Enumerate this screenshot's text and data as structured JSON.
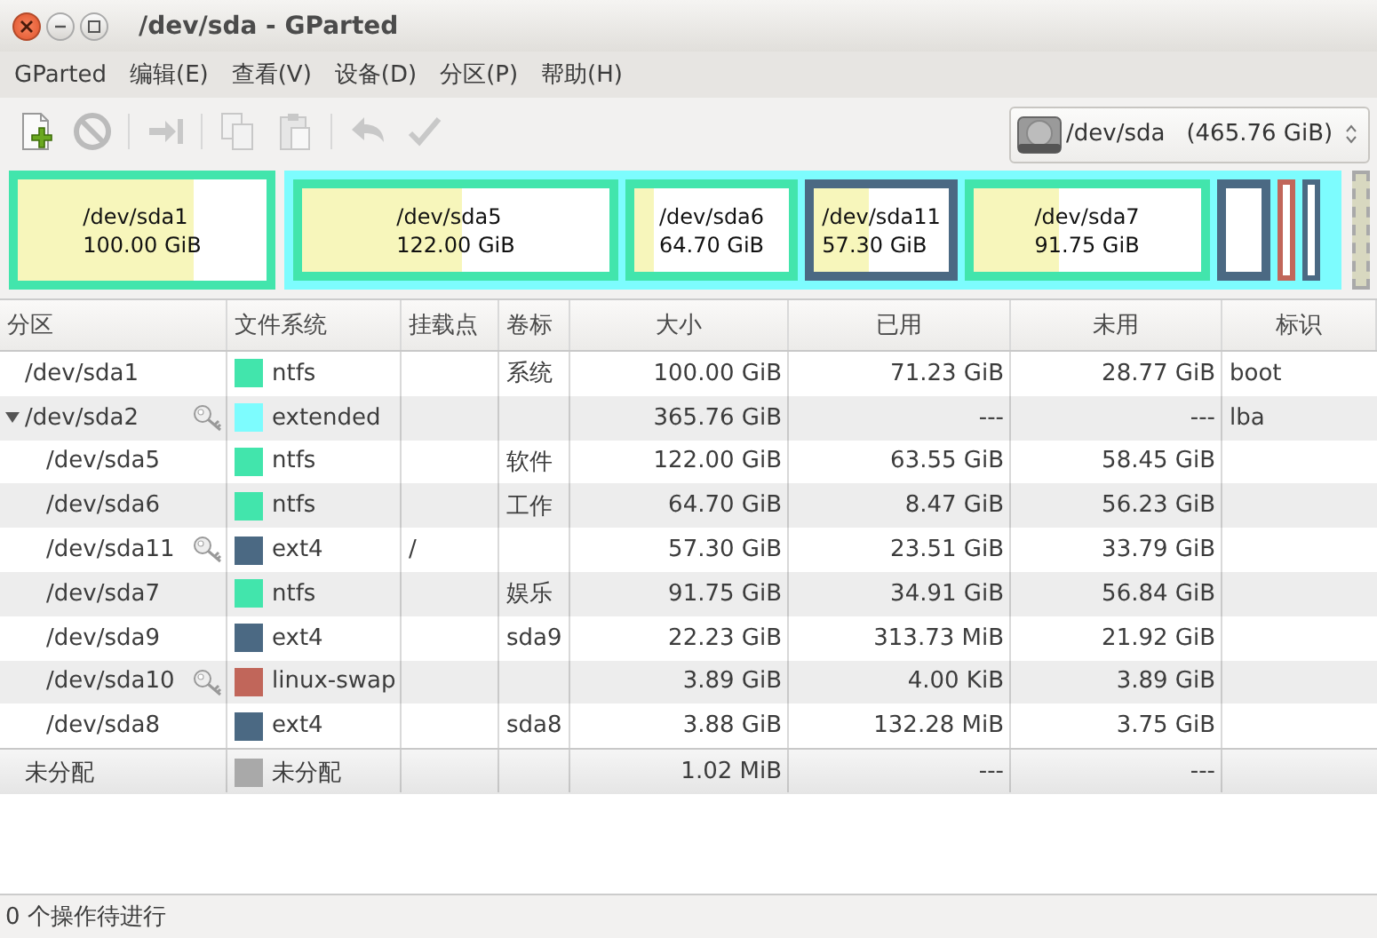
{
  "window": {
    "title": "/dev/sda - GParted"
  },
  "menu": [
    "GParted",
    "编辑(E)",
    "查看(V)",
    "设备(D)",
    "分区(P)",
    "帮助(H)"
  ],
  "toolbar": [
    {
      "kind": "new",
      "disabled": false
    },
    {
      "kind": "delete",
      "disabled": true
    },
    {
      "kind": "resize",
      "disabled": true
    },
    {
      "kind": "copy",
      "disabled": true
    },
    {
      "kind": "paste",
      "disabled": true
    },
    {
      "kind": "undo",
      "disabled": true
    },
    {
      "kind": "apply",
      "disabled": true
    }
  ],
  "device": {
    "name": "/dev/sda",
    "size": "(465.76 GiB)"
  },
  "disk_map": [
    {
      "kind": "partition",
      "label": "/dev/sda1",
      "size": "100.00 GiB",
      "color": "#42e5ac",
      "level": 0.71
    },
    {
      "kind": "extended",
      "color": "#7dfcfe",
      "children": [
        {
          "kind": "partition",
          "label": "/dev/sda5",
          "size": "122.00 GiB",
          "color": "#42e5ac",
          "level": 0.52
        },
        {
          "kind": "partition",
          "label": "/dev/sda6",
          "size": "64.70 GiB",
          "color": "#42e5ac",
          "level": 0.13
        },
        {
          "kind": "partition",
          "label": "/dev/sda11",
          "size": "57.30 GiB",
          "color": "#4b6983",
          "level": 0.41
        },
        {
          "kind": "partition",
          "label": "/dev/sda7",
          "size": "91.75 GiB",
          "color": "#42e5ac",
          "level": 0.38
        },
        {
          "kind": "small",
          "color": "#4b6983"
        },
        {
          "kind": "thin",
          "color": "#c1665a"
        },
        {
          "kind": "thin",
          "color": "#4b6983"
        }
      ]
    },
    {
      "kind": "unallocated",
      "color": "#a9a9a9"
    }
  ],
  "table": {
    "columns": [
      "分区",
      "文件系统",
      "挂载点",
      "卷标",
      "大小",
      "已用",
      "未用",
      "标识"
    ],
    "rows": [
      {
        "kind": "partition",
        "partition": "/dev/sda1",
        "locked": false,
        "color": "#42e5ac",
        "filesystem": "ntfs",
        "label": "系统",
        "size": "100.00 GiB",
        "used": "71.23 GiB",
        "unused": "28.77 GiB",
        "flags": "boot"
      },
      {
        "kind": "partition",
        "partition": "/dev/sda2",
        "locked": true,
        "expanded": true,
        "color": "#7dfcfe",
        "filesystem": "extended",
        "size": "365.76 GiB",
        "used": "---",
        "unused": "---",
        "flags": "lba",
        "children": [
          {
            "kind": "partition",
            "partition": "/dev/sda5",
            "locked": false,
            "color": "#42e5ac",
            "filesystem": "ntfs",
            "label": "软件",
            "size": "122.00 GiB",
            "used": "63.55 GiB",
            "unused": "58.45 GiB"
          },
          {
            "kind": "partition",
            "partition": "/dev/sda6",
            "locked": false,
            "color": "#42e5ac",
            "filesystem": "ntfs",
            "label": "工作",
            "size": "64.70 GiB",
            "used": "8.47 GiB",
            "unused": "56.23 GiB"
          },
          {
            "kind": "partition",
            "partition": "/dev/sda11",
            "locked": true,
            "color": "#4b6983",
            "filesystem": "ext4",
            "mount": "/",
            "size": "57.30 GiB",
            "used": "23.51 GiB",
            "unused": "33.79 GiB"
          },
          {
            "kind": "partition",
            "partition": "/dev/sda7",
            "locked": false,
            "color": "#42e5ac",
            "filesystem": "ntfs",
            "label": "娱乐",
            "size": "91.75 GiB",
            "used": "34.91 GiB",
            "unused": "56.84 GiB"
          },
          {
            "kind": "partition",
            "partition": "/dev/sda9",
            "locked": false,
            "color": "#4b6983",
            "filesystem": "ext4",
            "label": "sda9",
            "size": "22.23 GiB",
            "used": "313.73 MiB",
            "unused": "21.92 GiB"
          },
          {
            "kind": "partition",
            "partition": "/dev/sda10",
            "locked": true,
            "color": "#c1665a",
            "filesystem": "linux-swap",
            "size": "3.89 GiB",
            "used": "4.00 KiB",
            "unused": "3.89 GiB"
          },
          {
            "kind": "partition",
            "partition": "/dev/sda8",
            "locked": false,
            "color": "#4b6983",
            "filesystem": "ext4",
            "label": "sda8",
            "size": "3.88 GiB",
            "used": "132.28 MiB",
            "unused": "3.75 GiB"
          }
        ]
      },
      {
        "kind": "unallocated",
        "partition": "未分配",
        "locked": false,
        "color": "#a9a9a9",
        "filesystem": "未分配",
        "size": "1.02 MiB",
        "used": "---",
        "unused": "---"
      }
    ]
  },
  "status_bar": "0 个操作待进行"
}
